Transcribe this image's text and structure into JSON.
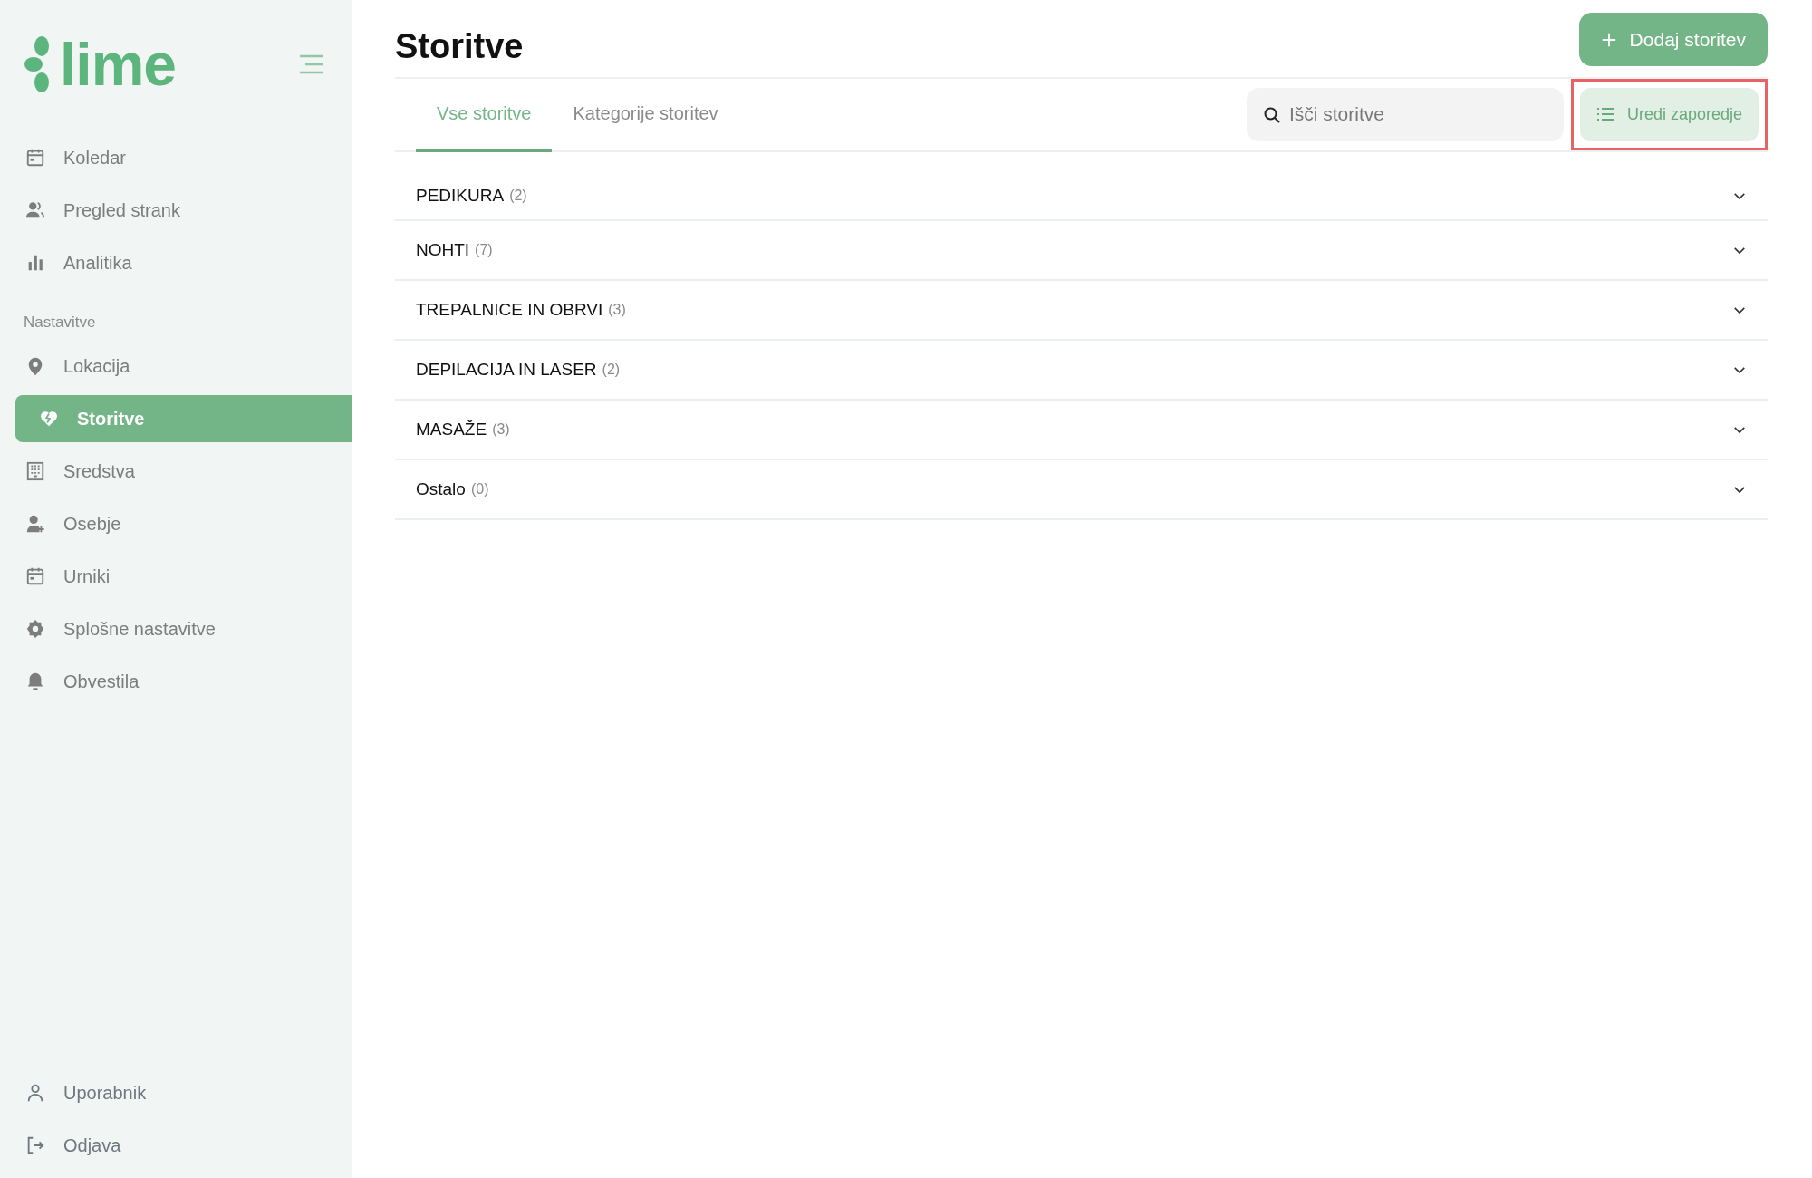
{
  "sidebar": {
    "logo": "lime",
    "items": [
      {
        "label": "Koledar",
        "kind": "calendar",
        "selected": false
      },
      {
        "label": "Pregled strank",
        "kind": "users",
        "selected": false
      },
      {
        "label": "Analitika",
        "kind": "chart",
        "selected": false
      }
    ],
    "section_title": "Nastavitve",
    "settings_items": [
      {
        "label": "Lokacija",
        "kind": "pin",
        "selected": false
      },
      {
        "label": "Storitve",
        "kind": "heart",
        "selected": true
      },
      {
        "label": "Sredstva",
        "kind": "building",
        "selected": false
      },
      {
        "label": "Osebje",
        "kind": "user-plus",
        "selected": false
      },
      {
        "label": "Urniki",
        "kind": "calendar",
        "selected": false
      },
      {
        "label": "Splošne nastavitve",
        "kind": "gear",
        "selected": false
      },
      {
        "label": "Obvestila",
        "kind": "bell",
        "selected": false
      }
    ],
    "footer_items": [
      {
        "label": "Uporabnik",
        "kind": "user"
      },
      {
        "label": "Odjava",
        "kind": "logout"
      }
    ]
  },
  "page": {
    "title": "Storitve",
    "add_button": "Dodaj storitev",
    "tabs": [
      {
        "label": "Vse storitve",
        "selected": true
      },
      {
        "label": "Kategorije storitev",
        "selected": false
      }
    ],
    "search": {
      "placeholder": "Išči storitve"
    },
    "reorder_button": {
      "label": "Uredi zaporedje",
      "highlighted": true
    },
    "categories": [
      {
        "name": "PEDIKURA",
        "count": "(2)",
        "expanded": false
      },
      {
        "name": "NOHTI",
        "count": "(7)",
        "expanded": false
      },
      {
        "name": "TREPALNICE IN OBRVI",
        "count": "(3)",
        "expanded": false
      },
      {
        "name": "DEPILACIJA IN LASER",
        "count": "(2)",
        "expanded": false
      },
      {
        "name": "MASAŽE",
        "count": "(3)",
        "expanded": false
      },
      {
        "name": "Ostalo",
        "count": "(0)",
        "expanded": false
      }
    ]
  }
}
